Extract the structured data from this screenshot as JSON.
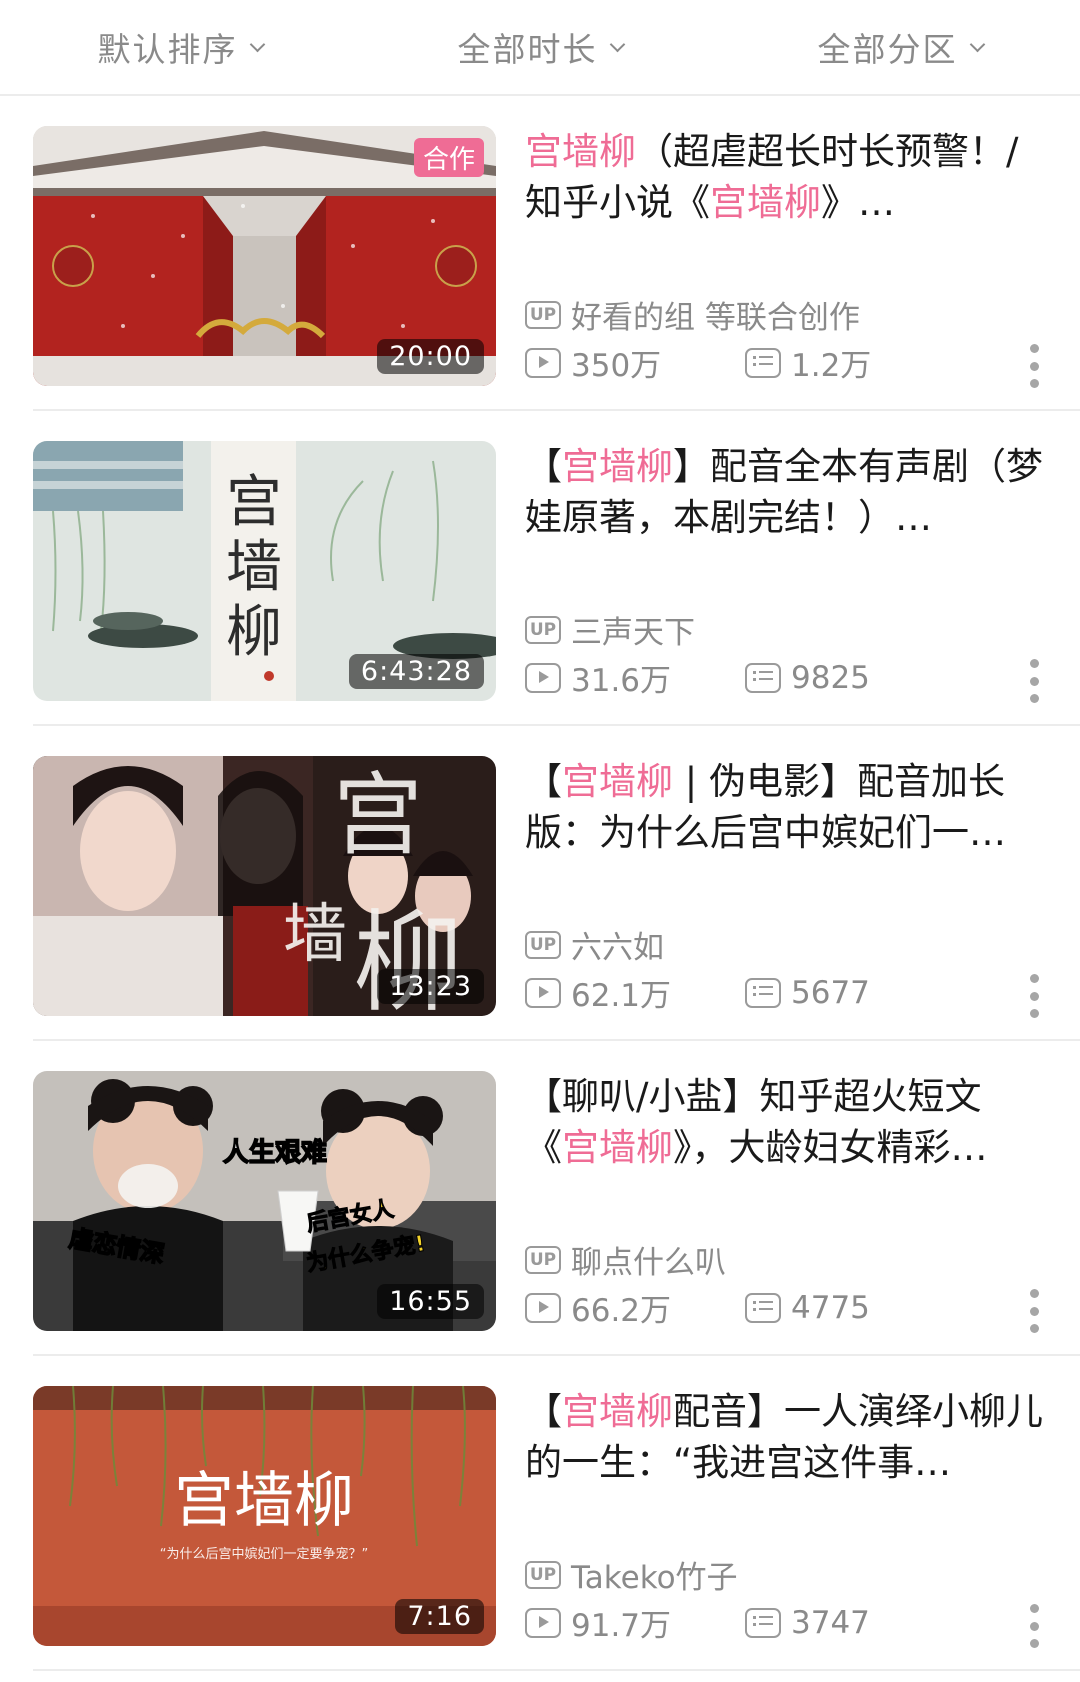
{
  "filters": [
    {
      "label": "默认排序"
    },
    {
      "label": "全部时长"
    },
    {
      "label": "全部分区"
    }
  ],
  "videos": [
    {
      "badge": "合作",
      "duration": "20:00",
      "title_parts": [
        {
          "text": "宫墙柳",
          "hl": true
        },
        {
          "text": "（超虐超长时长预警！/知乎小说《",
          "hl": false
        },
        {
          "text": "宫墙柳",
          "hl": true
        },
        {
          "text": "》…",
          "hl": false
        }
      ],
      "uploader": "好看的组 等联合创作",
      "views": "350万",
      "danmaku": "1.2万"
    },
    {
      "badge": "",
      "duration": "6:43:28",
      "title_parts": [
        {
          "text": "【",
          "hl": false
        },
        {
          "text": "宫墙柳",
          "hl": true
        },
        {
          "text": "】配音全本有声剧（梦娃原著，本剧完结！）…",
          "hl": false
        }
      ],
      "uploader": "三声天下",
      "views": "31.6万",
      "danmaku": "9825"
    },
    {
      "badge": "",
      "duration": "13:23",
      "title_parts": [
        {
          "text": "【",
          "hl": false
        },
        {
          "text": "宫墙柳",
          "hl": true
        },
        {
          "text": " | 伪电影】配音加长版：为什么后宫中嫔妃们一…",
          "hl": false
        }
      ],
      "uploader": "六六如",
      "views": "62.1万",
      "danmaku": "5677"
    },
    {
      "badge": "",
      "duration": "16:55",
      "title_parts": [
        {
          "text": "【聊叭/小盐】知乎超火短文《",
          "hl": false
        },
        {
          "text": "宫墙柳",
          "hl": true
        },
        {
          "text": "》，大龄妇女精彩…",
          "hl": false
        }
      ],
      "uploader": "聊点什么叭",
      "views": "66.2万",
      "danmaku": "4775"
    },
    {
      "badge": "",
      "duration": "7:16",
      "title_parts": [
        {
          "text": "【",
          "hl": false
        },
        {
          "text": "宫墙柳",
          "hl": true
        },
        {
          "text": "配音】一人演绎小柳儿的一生：“我进宫这件事…",
          "hl": false
        }
      ],
      "uploader": "Takeko竹子",
      "views": "91.7万",
      "danmaku": "3747"
    }
  ],
  "icons": {
    "uploader": "up-badge-icon",
    "views": "play-count-icon",
    "danmaku": "danmaku-count-icon",
    "more": "more-vertical-icon",
    "filter": "chevron-down-icon"
  },
  "colors": {
    "accent": "#ef6c95",
    "muted": "#8a8a8a"
  },
  "up_label": "UP"
}
